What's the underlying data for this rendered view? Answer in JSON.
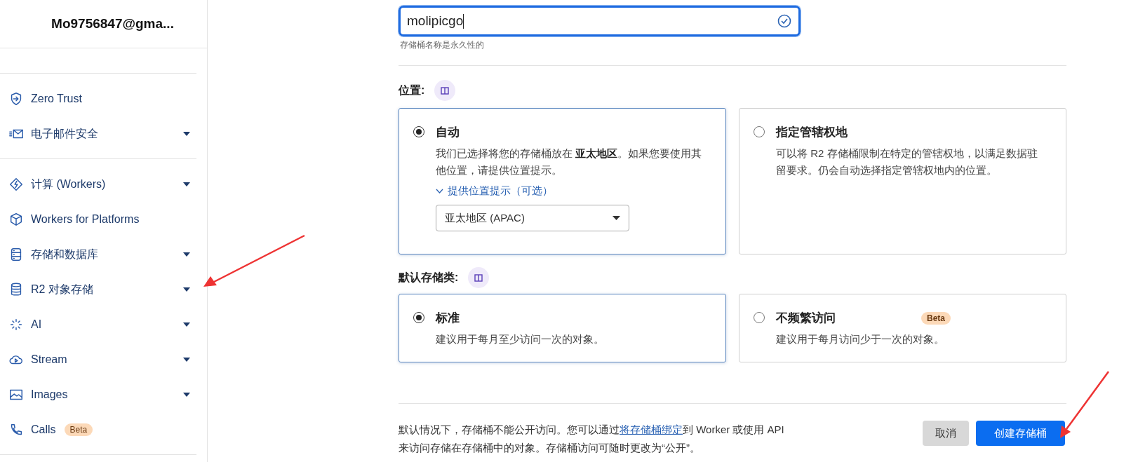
{
  "sidebar": {
    "account": "Mo9756847@gma...",
    "groups": [
      {
        "items": [
          {
            "label": "Zero Trust",
            "has_menu": false
          },
          {
            "label": "电子邮件安全",
            "has_menu": true
          }
        ]
      },
      {
        "items": [
          {
            "label": "计算 (Workers)",
            "has_menu": true
          },
          {
            "label": "Workers for Platforms",
            "has_menu": false
          },
          {
            "label": "存储和数据库",
            "has_menu": true
          },
          {
            "label": "R2 对象存储",
            "has_menu": true
          },
          {
            "label": "AI",
            "has_menu": true
          },
          {
            "label": "Stream",
            "has_menu": true
          },
          {
            "label": "Images",
            "has_menu": true
          },
          {
            "label": "Calls",
            "has_menu": false,
            "badge": "Beta"
          }
        ]
      }
    ]
  },
  "bucket_name": {
    "value": "molipicgo",
    "valid": true,
    "hint": "存储桶名称是永久性的"
  },
  "location": {
    "label": "位置:",
    "options": [
      {
        "title": "自动",
        "description": "我们已选择将您的存储桶放在 **亚太地区**。如果您要使用其他位置，请提供位置提示。",
        "selected": true,
        "hint_toggle": "提供位置提示（可选）",
        "hint_value": "亚太地区 (APAC)"
      },
      {
        "title": "指定管辖权地",
        "description": "可以将 R2 存储桶限制在特定的管辖权地，以满足数据驻留要求。仍会自动选择指定管辖权地内的位置。",
        "selected": false
      }
    ]
  },
  "storage_class": {
    "label": "默认存储类:",
    "options": [
      {
        "title": "标准",
        "description": "建议用于每月至少访问一次的对象。",
        "selected": true
      },
      {
        "title": "不频繁访问",
        "description": "建议用于每月访问少于一次的对象。",
        "selected": false,
        "badge": "Beta"
      }
    ]
  },
  "footer": {
    "note_before": "默认情况下，存储桶不能公开访问。您可以通过",
    "note_link": "将存储桶绑定",
    "note_after": "到 Worker 或使用 API 来访问存储在存储桶中的对象。存储桶访问可随时更改为“公开”。",
    "buttons": [
      {
        "label": "取消",
        "kind": "secondary"
      },
      {
        "label": "创建存储桶",
        "kind": "primary"
      }
    ]
  }
}
